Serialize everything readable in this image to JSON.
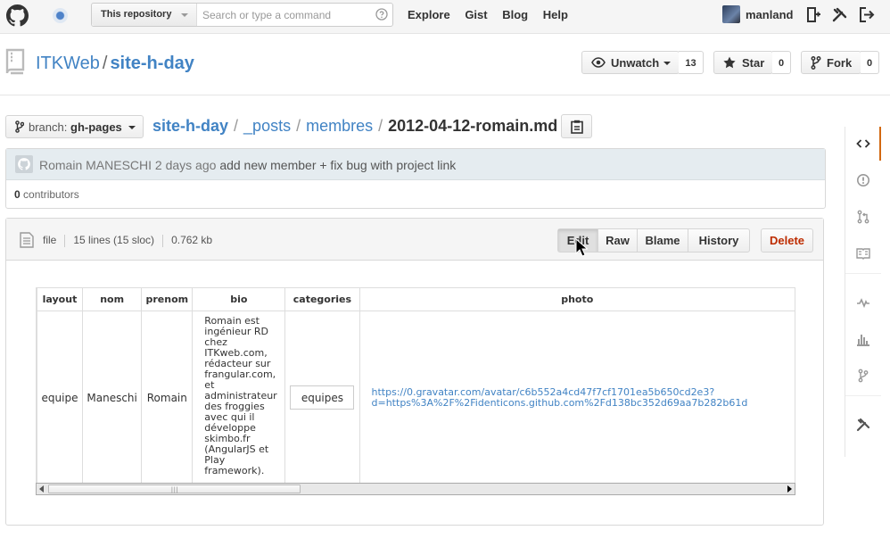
{
  "header": {
    "search_scope": "This repository",
    "search_placeholder": "Search or type a command",
    "nav": [
      "Explore",
      "Gist",
      "Blog",
      "Help"
    ],
    "username": "manland"
  },
  "repo": {
    "owner": "ITKWeb",
    "separator": "/",
    "name": "site-h-day",
    "watch": {
      "label": "Unwatch",
      "count": "13"
    },
    "star": {
      "label": "Star",
      "count": "0"
    },
    "fork": {
      "label": "Fork",
      "count": "0"
    }
  },
  "file_nav": {
    "branch_prefix": "branch:",
    "branch": "gh-pages",
    "breadcrumb": [
      "site-h-day",
      "_posts",
      "membres"
    ],
    "separator": "/",
    "filename": "2012-04-12-romain.md"
  },
  "commit": {
    "author": "Romain MANESCHI",
    "age": "2 days ago",
    "message": "add new member + fix bug with project link",
    "contributors_count": "0",
    "contributors_label": "contributors"
  },
  "file": {
    "type": "file",
    "lines": "15 lines (15 sloc)",
    "size": "0.762 kb",
    "actions": [
      "Edit",
      "Raw",
      "Blame",
      "History"
    ],
    "active_action": "Edit",
    "delete_label": "Delete"
  },
  "frontmatter": {
    "headers": [
      "layout",
      "nom",
      "prenom",
      "bio",
      "categories",
      "photo"
    ],
    "row": {
      "layout": "equipe",
      "nom": "Maneschi",
      "prenom": "Romain",
      "bio_lines": [
        "Romain est",
        "ingénieur RD",
        "chez",
        "ITKweb.com,",
        "rédacteur sur",
        "frangular.com,",
        "et",
        "administrateur",
        "des froggies",
        "avec qui il",
        "développe",
        "skimbo.fr",
        "(AngularJS et",
        "Play",
        "framework)."
      ],
      "categories": "equipes",
      "photo_line1": "https://0.gravatar.com/avatar/c6b552a4cd47f7cf1701ea5b650cd2e3?",
      "photo_line2": "d=https%3A%2F%2Fidenticons.github.com%2Fd138bc352d69aa7b282b61d"
    }
  },
  "sidebar": {
    "items": [
      "code-icon",
      "issues-icon",
      "pull-requests-icon",
      "wiki-icon",
      "pulse-icon",
      "graphs-icon",
      "network-icon",
      "settings-icon"
    ],
    "selected": "code-icon"
  },
  "colors": {
    "link": "#4183c4",
    "delete": "#bd2c00",
    "selected_tab": "#d26911",
    "commit_bar": "#e5ecf0"
  }
}
